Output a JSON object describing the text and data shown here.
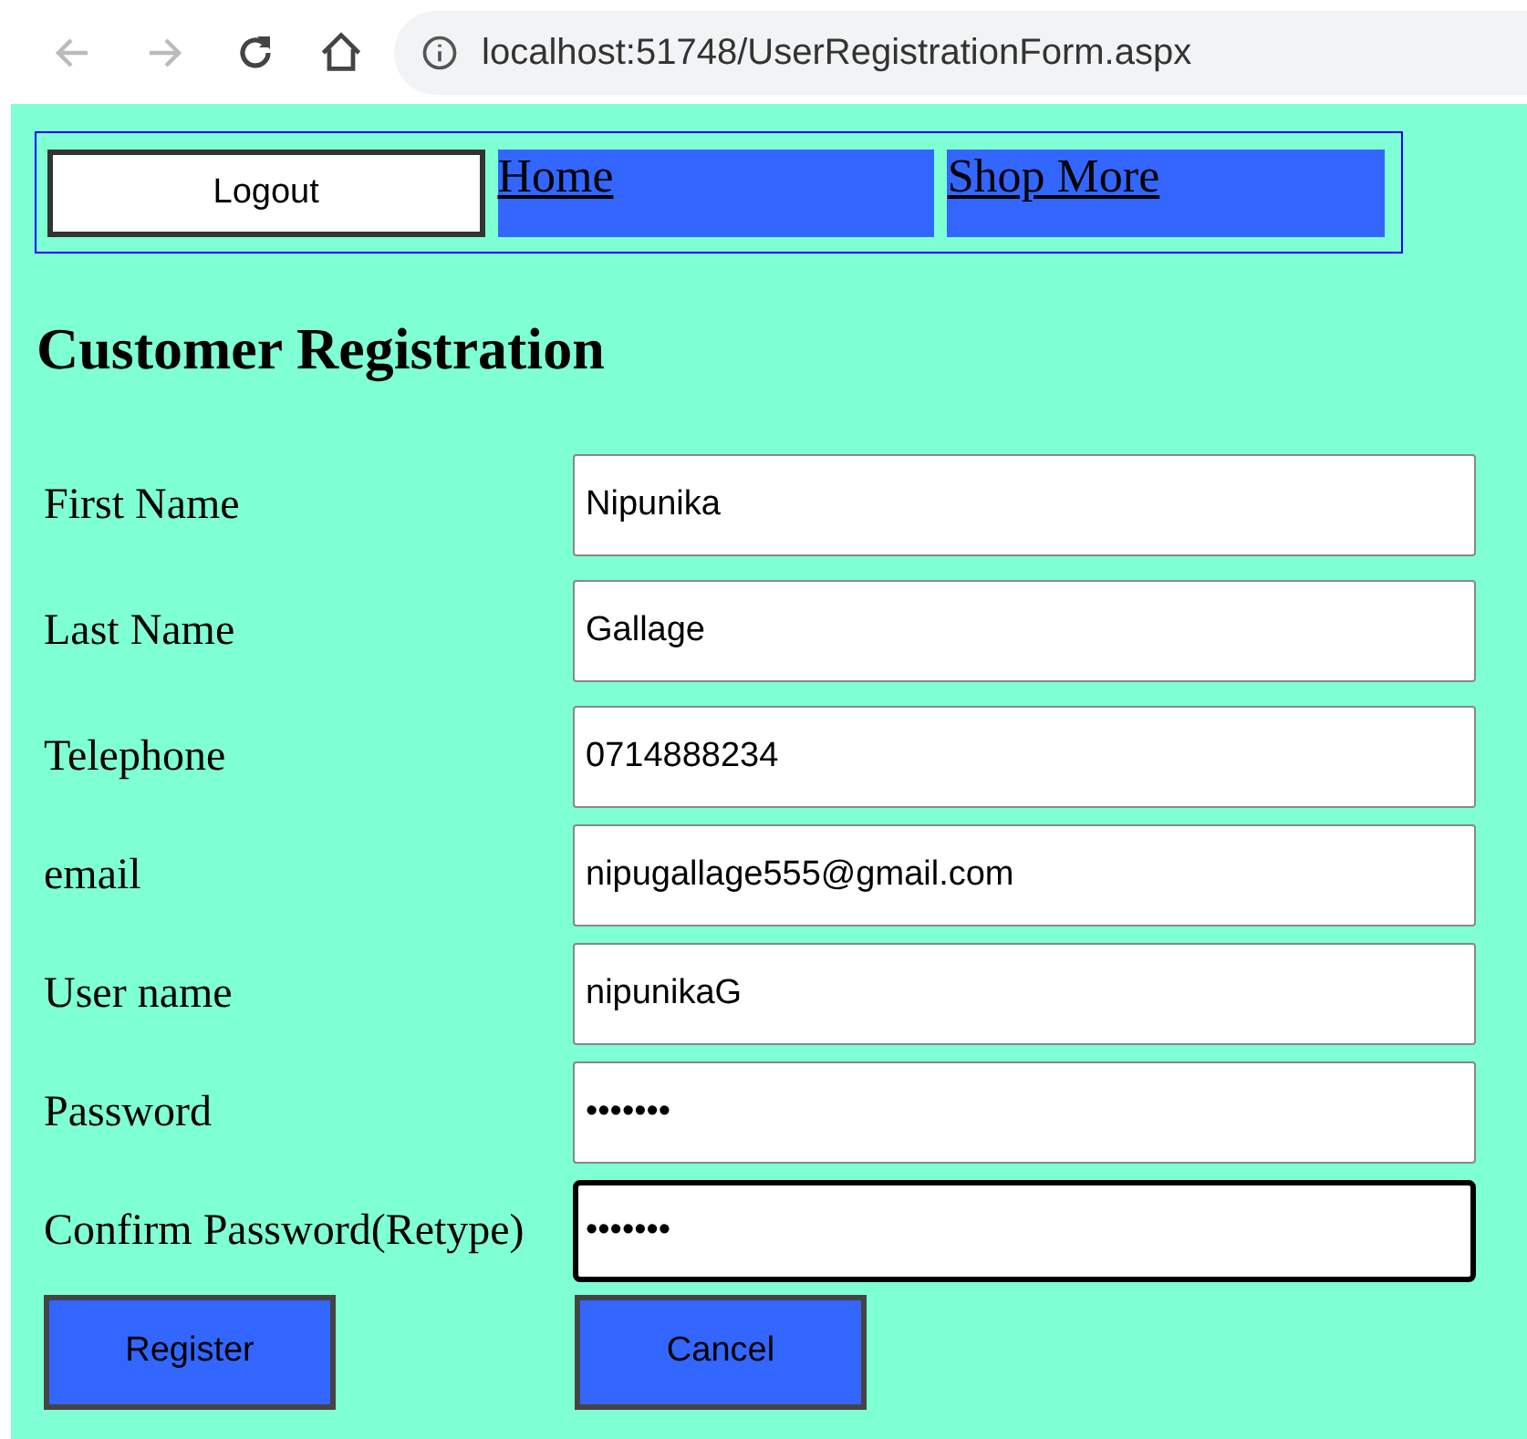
{
  "browser": {
    "address": "localhost:51748/UserRegistrationForm.aspx"
  },
  "nav": {
    "logout": "Logout",
    "links": [
      "Home",
      "Shop More"
    ]
  },
  "heading": "Customer Registration",
  "fields": [
    {
      "label": "First Name",
      "value": "Nipunika",
      "focused": false
    },
    {
      "label": "Last Name",
      "value": "Gallage",
      "focused": false
    },
    {
      "label": "Telephone",
      "value": "0714888234",
      "focused": false
    },
    {
      "label": "email",
      "value": "nipugallage555@gmail.com",
      "focused": false
    },
    {
      "label": "User name",
      "value": "nipunikaG",
      "focused": false
    },
    {
      "label": "Password",
      "value": "•••••••",
      "focused": false
    },
    {
      "label": "Confirm Password(Retype)",
      "value": "•••••••",
      "focused": true
    }
  ],
  "buttons": [
    "Register",
    "Cancel"
  ]
}
